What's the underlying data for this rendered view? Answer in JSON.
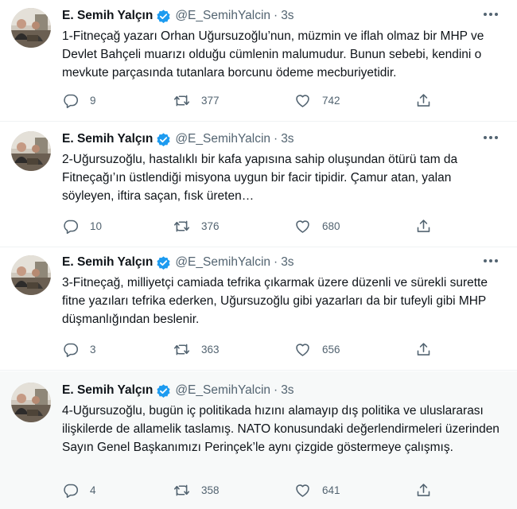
{
  "author": {
    "name": "E. Semih Yalçın",
    "handle": "@E_SemihYalcin",
    "time": "3s",
    "separator": "·"
  },
  "icons": {
    "verified": "verified-badge-icon",
    "more": "more-options-icon",
    "reply": "reply-icon",
    "retweet": "retweet-icon",
    "like": "like-icon",
    "share": "share-icon"
  },
  "colors": {
    "verified_blue": "#1d9bf0",
    "secondary_text": "#536471",
    "hover_background": "#f7f9f9"
  },
  "tweets": [
    {
      "text": "1-Fitneçağ yazarı Orhan Uğursuzoğlu’nun, müzmin ve iflah olmaz bir MHP ve Devlet Bahçeli muarızı olduğu cümlenin malumudur. Bunun sebebi, kendini o mevkute parçasında tutanlara borcunu ödeme mecburiyetidir.",
      "replies": "9",
      "retweets": "377",
      "likes": "742"
    },
    {
      "text": "2-Uğursuzoğlu, hastalıklı bir kafa yapısına sahip oluşundan ötürü tam da Fitneçağı’ın üstlendiği misyona uygun bir facir tipidir. Çamur atan, yalan söyleyen, iftira saçan, fısk üreten…",
      "replies": "10",
      "retweets": "376",
      "likes": "680"
    },
    {
      "text": "3-Fitneçağ, milliyetçi camiada tefrika çıkarmak üzere düzenli ve sürekli surette fitne yazıları tefrika ederken, Uğursuzoğlu gibi yazarları da bir tufeyli gibi MHP düşmanlığından beslenir.",
      "replies": "3",
      "retweets": "363",
      "likes": "656"
    },
    {
      "text": "4-Uğursuzoğlu, bugün iç politikada hızını alamayıp dış politika ve uluslararası ilişkilerde de allamelik taslamış. NATO konusundaki değerlendirmeleri üzerinden Sayın Genel Başkanımızı Perinçek’le aynı çizgide göstermeye çalışmış.",
      "replies": "4",
      "retweets": "358",
      "likes": "641"
    }
  ]
}
